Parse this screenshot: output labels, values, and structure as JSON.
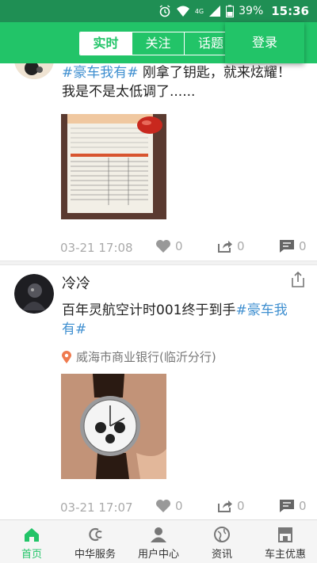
{
  "status_bar": {
    "network": "4G",
    "battery": "39%",
    "time": "15:36"
  },
  "header": {
    "tabs": [
      {
        "label": "实时",
        "active": true
      },
      {
        "label": "关注",
        "active": false
      },
      {
        "label": "话题",
        "active": false
      }
    ],
    "login_label": "登录"
  },
  "posts": [
    {
      "username": "",
      "hashtag": "#豪车我有#",
      "text": " 刚拿了钥匙，就来炫耀！我是不是太低调了......",
      "date": "03-21 17:08",
      "likes": "0",
      "shares": "0",
      "comments": "0"
    },
    {
      "username": "冷冷",
      "text": "百年灵航空计时001终于到手",
      "hashtag": "#豪车我有#",
      "location": "威海市商业银行(临沂分行)",
      "date": "03-21 17:07",
      "likes": "0",
      "shares": "0",
      "comments": "0"
    }
  ],
  "bottom_nav": [
    {
      "label": "首页",
      "icon": "home-icon",
      "active": true
    },
    {
      "label": "中华服务",
      "icon": "service-logo-icon",
      "active": false
    },
    {
      "label": "用户中心",
      "icon": "user-icon",
      "active": false
    },
    {
      "label": "资讯",
      "icon": "globe-icon",
      "active": false
    },
    {
      "label": "车主优惠",
      "icon": "shop-icon",
      "active": false
    }
  ],
  "colors": {
    "accent": "#22c468",
    "status_bar": "#1f8f54",
    "hashtag": "#3f8fd0"
  }
}
